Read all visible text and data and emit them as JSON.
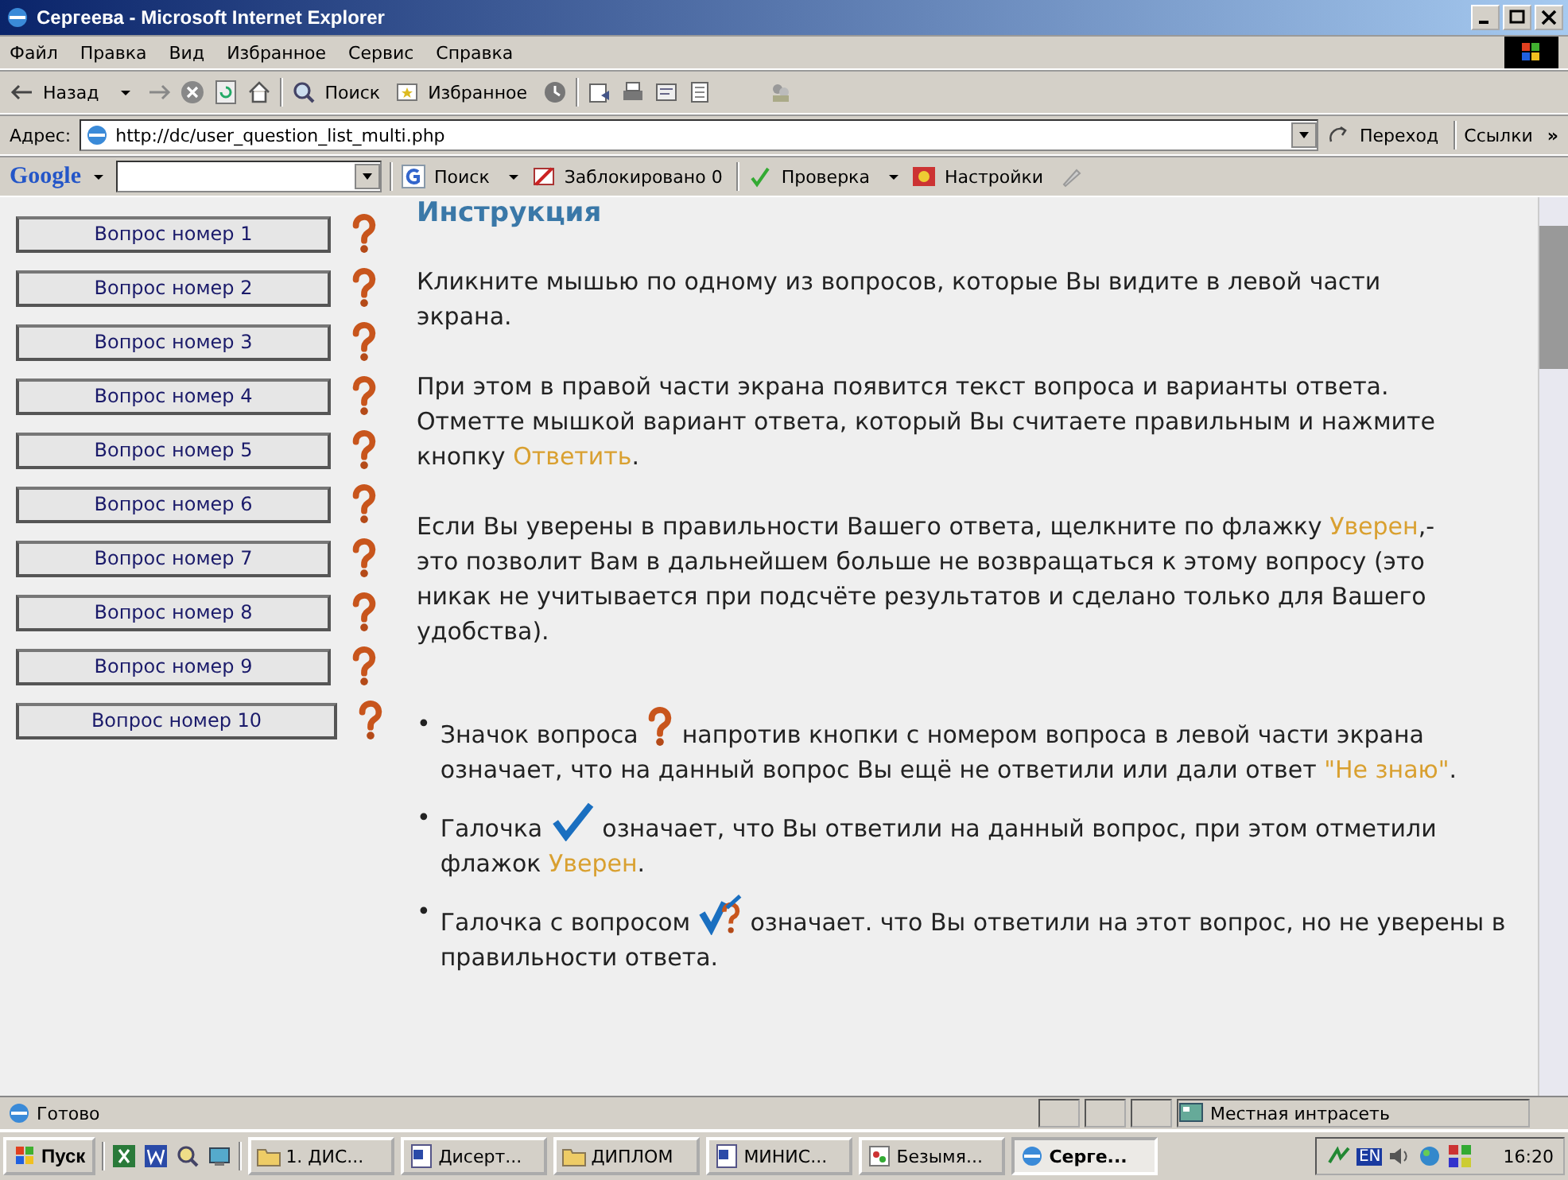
{
  "window": {
    "title": "Сергеева - Microsoft Internet Explorer"
  },
  "menu": [
    "Файл",
    "Правка",
    "Вид",
    "Избранное",
    "Сервис",
    "Справка"
  ],
  "toolbar": {
    "back": "Назад",
    "search": "Поиск",
    "favorites": "Избранное"
  },
  "address": {
    "label": "Адрес:",
    "value": "http://dc/user_question_list_multi.php",
    "go": "Переход",
    "links": "Ссылки",
    "more": "»"
  },
  "google_bar": {
    "logo": "Google",
    "search": "Поиск",
    "blocked": "Заблокировано 0",
    "check": "Проверка",
    "settings": "Настройки"
  },
  "questions": [
    {
      "label": "Вопрос номер 1"
    },
    {
      "label": "Вопрос номер 2"
    },
    {
      "label": "Вопрос номер 3"
    },
    {
      "label": "Вопрос номер 4"
    },
    {
      "label": "Вопрос номер 5"
    },
    {
      "label": "Вопрос номер 6"
    },
    {
      "label": "Вопрос номер 7"
    },
    {
      "label": "Вопрос номер 8"
    },
    {
      "label": "Вопрос номер 9"
    },
    {
      "label": "Вопрос номер 10"
    }
  ],
  "instructions": {
    "heading": "Инструкция",
    "paragraphs": [
      [
        {
          "kind": "text",
          "text": "Кликните мышью по одному из вопросов, которые Вы видите в левой части экрана."
        }
      ],
      [
        {
          "kind": "text",
          "text": "При этом в правой части экрана появится текст вопроса и варианты ответа. Отметте мышкой вариант ответа, который Вы считаете правильным и нажмите кнопку "
        },
        {
          "kind": "accent",
          "text": "Ответить"
        },
        {
          "kind": "text",
          "text": "."
        }
      ],
      [
        {
          "kind": "text",
          "text": "Если Вы уверены в правильности Вашего ответа, щелкните по флажку "
        },
        {
          "kind": "accent",
          "text": "Уверен"
        },
        {
          "kind": "text",
          "text": ",- это позволит Вам в дальнейшем больше не возвращаться к этому вопросу (это никак не учитывается при подсчёте результатов и сделано только для Вашего удобства)."
        }
      ]
    ],
    "legend": [
      {
        "bullet": "•",
        "before": "Значок вопроса",
        "after": [
          {
            "kind": "text",
            "text": "напротив кнопки с номером вопроса в левой части экрана означает, что на данный вопрос Вы ещё не ответили или дали ответ "
          },
          {
            "kind": "accent",
            "text": "\"Не знаю\""
          },
          {
            "kind": "text",
            "text": "."
          }
        ]
      },
      {
        "bullet": "•",
        "before": "Галочка",
        "after": [
          {
            "kind": "text",
            "text": "означает, что Вы ответили на данный вопрос, при этом отметили флажок "
          },
          {
            "kind": "accent",
            "text": "Уверен"
          },
          {
            "kind": "text",
            "text": "."
          }
        ]
      },
      {
        "bullet": "•",
        "before": "Галочка с вопросом",
        "after": [
          {
            "kind": "text",
            "text": "означает. что Вы ответили на этот вопрос, но не уверены в правильности ответа."
          }
        ]
      }
    ]
  },
  "status_bar": {
    "text": "Готово",
    "zone": "Местная интрасеть"
  },
  "taskbar": {
    "start": "Пуск",
    "tasks": [
      {
        "label": "1. ДИС...",
        "selected": false
      },
      {
        "label": "Дисерт...",
        "selected": false
      },
      {
        "label": "ДИПЛОМ",
        "selected": false
      },
      {
        "label": "МИНИС...",
        "selected": false
      },
      {
        "label": "Безымя...",
        "selected": false
      },
      {
        "label": "Серге...",
        "selected": true
      }
    ],
    "lang": "EN",
    "clock": "16:20"
  }
}
